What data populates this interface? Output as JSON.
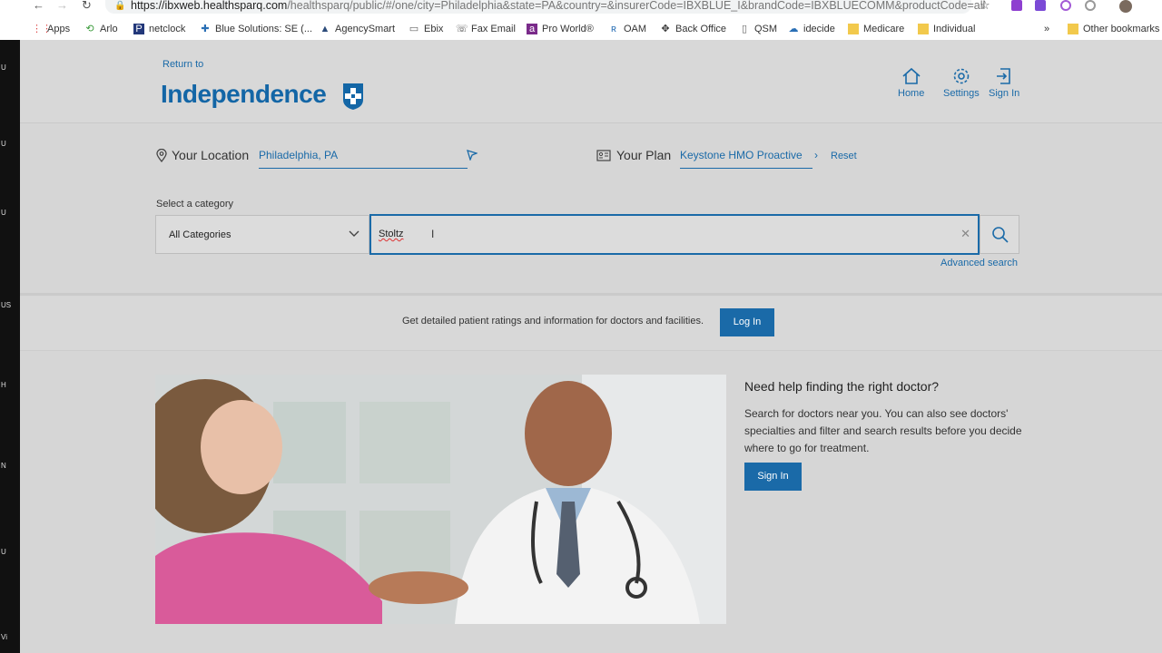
{
  "browser": {
    "url_host": "https://ibxweb.healthsparq.com",
    "url_path": "/healthsparq/public/#/one/city=Philadelphia&state=PA&country=&insurerCode=IBXBLUE_I&brandCode=IBXBLUECOMM&productCode=all",
    "bookmarks": [
      "Apps",
      "Arlo",
      "netclock",
      "Blue Solutions: SE (...",
      "AgencySmart",
      "Ebix",
      "Fax Email",
      "Pro World®",
      "OAM",
      "Back Office",
      "QSM",
      "idecide",
      "Medicare",
      "Individual"
    ],
    "bookmarks_more": "»",
    "other_bookmarks": "Other bookmarks",
    "left_strip_letters": [
      "U",
      "U",
      "U",
      "US",
      "H",
      "N",
      "U",
      "Vi"
    ]
  },
  "header": {
    "return_to": "Return to",
    "brand": "Independence",
    "nav": [
      {
        "label": "Home",
        "icon": "home-icon"
      },
      {
        "label": "Settings",
        "icon": "gear-icon"
      },
      {
        "label": "Sign In",
        "icon": "sign-in-icon"
      }
    ]
  },
  "search": {
    "location_label": "Your Location",
    "location_value": "Philadelphia, PA",
    "plan_label": "Your Plan",
    "plan_value": "Keystone HMO Proactive",
    "reset": "Reset",
    "category_label": "Select a category",
    "category_value": "All Categories",
    "query_value": "Stoltz",
    "advanced": "Advanced search"
  },
  "login_band": {
    "text": "Get detailed patient ratings and information for doctors and facilities.",
    "button": "Log In"
  },
  "help": {
    "title": "Need help finding the right doctor?",
    "body": "Search for doctors near you. You can also see doctors' specialties and filter and search results before you decide where to go for treatment.",
    "button": "Sign In"
  },
  "colors": {
    "brand_blue": "#1366a6",
    "link_blue": "#1a6aa8",
    "page_bg": "#d6d6d6"
  }
}
